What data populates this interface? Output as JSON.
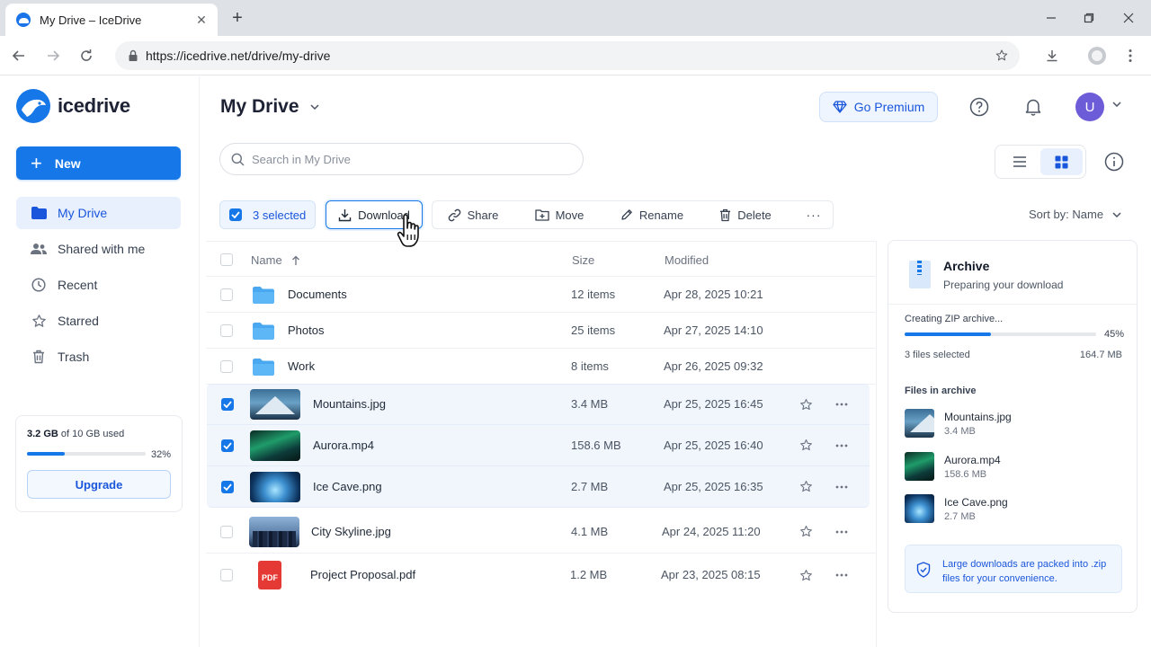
{
  "browser": {
    "tab_title": "My Drive – IceDrive",
    "tab_close": "✕",
    "new_tab": "+",
    "url": "https://icedrive.net/drive/my-drive"
  },
  "brand": {
    "name": "icedrive",
    "accent": "#1677e8"
  },
  "sidebar": {
    "new_label": "New",
    "items": [
      {
        "label": "My Drive",
        "icon": "folder-icon",
        "active": true
      },
      {
        "label": "Shared with me",
        "icon": "people-icon",
        "active": false
      },
      {
        "label": "Recent",
        "icon": "clock-icon",
        "active": false
      },
      {
        "label": "Starred",
        "icon": "star-icon",
        "active": false
      },
      {
        "label": "Trash",
        "icon": "trash-icon",
        "active": false
      }
    ],
    "storage": {
      "used": "3.2 GB",
      "of_text": "of 10 GB used",
      "percent_label": "32%",
      "percent": 32,
      "upgrade_label": "Upgrade"
    }
  },
  "header": {
    "title": "My Drive",
    "premium_label": "Go Premium",
    "avatar_initial": "U",
    "search_placeholder": "Search in My Drive"
  },
  "toolbar": {
    "selected_label": "3 selected",
    "download_label": "Download",
    "share_label": "Share",
    "move_label": "Move",
    "rename_label": "Rename",
    "delete_label": "Delete",
    "more_label": "···",
    "sort_label": "Sort by: Name"
  },
  "table": {
    "columns": {
      "name": "Name",
      "size": "Size",
      "modified": "Modified"
    },
    "rows": [
      {
        "name": "Documents",
        "size": "12 items",
        "modified": "Apr 28, 2025 10:21",
        "type": "folder",
        "selected": false
      },
      {
        "name": "Photos",
        "size": "25 items",
        "modified": "Apr 27, 2025 14:10",
        "type": "folder",
        "selected": false
      },
      {
        "name": "Work",
        "size": "8 items",
        "modified": "Apr 26, 2025 09:32",
        "type": "folder",
        "selected": false
      },
      {
        "name": "Mountains.jpg",
        "size": "3.4 MB",
        "modified": "Apr 25, 2025 16:45",
        "type": "image",
        "selected": true
      },
      {
        "name": "Aurora.mp4",
        "size": "158.6 MB",
        "modified": "Apr 25, 2025 16:40",
        "type": "video",
        "selected": true
      },
      {
        "name": "Ice Cave.png",
        "size": "2.7 MB",
        "modified": "Apr 25, 2025 16:35",
        "type": "image",
        "selected": true
      },
      {
        "name": "City Skyline.jpg",
        "size": "4.1 MB",
        "modified": "Apr 24, 2025 11:20",
        "type": "image",
        "selected": false
      },
      {
        "name": "Project Proposal.pdf",
        "size": "1.2 MB",
        "modified": "Apr 23, 2025 08:15",
        "type": "pdf",
        "selected": false
      }
    ],
    "pdf_badge": "PDF"
  },
  "archive": {
    "title": "Archive",
    "subtitle": "Preparing your download",
    "progress_label": "Creating ZIP archive...",
    "percent_label": "45%",
    "percent": 45,
    "files_selected": "3 files selected",
    "total_size": "164.7 MB",
    "section_title": "Files in archive",
    "files": [
      {
        "name": "Mountains.jpg",
        "size": "3.4 MB"
      },
      {
        "name": "Aurora.mp4",
        "size": "158.6 MB"
      },
      {
        "name": "Ice Cave.png",
        "size": "2.7 MB"
      }
    ],
    "note": "Large downloads are packed into .zip files for your convenience."
  }
}
